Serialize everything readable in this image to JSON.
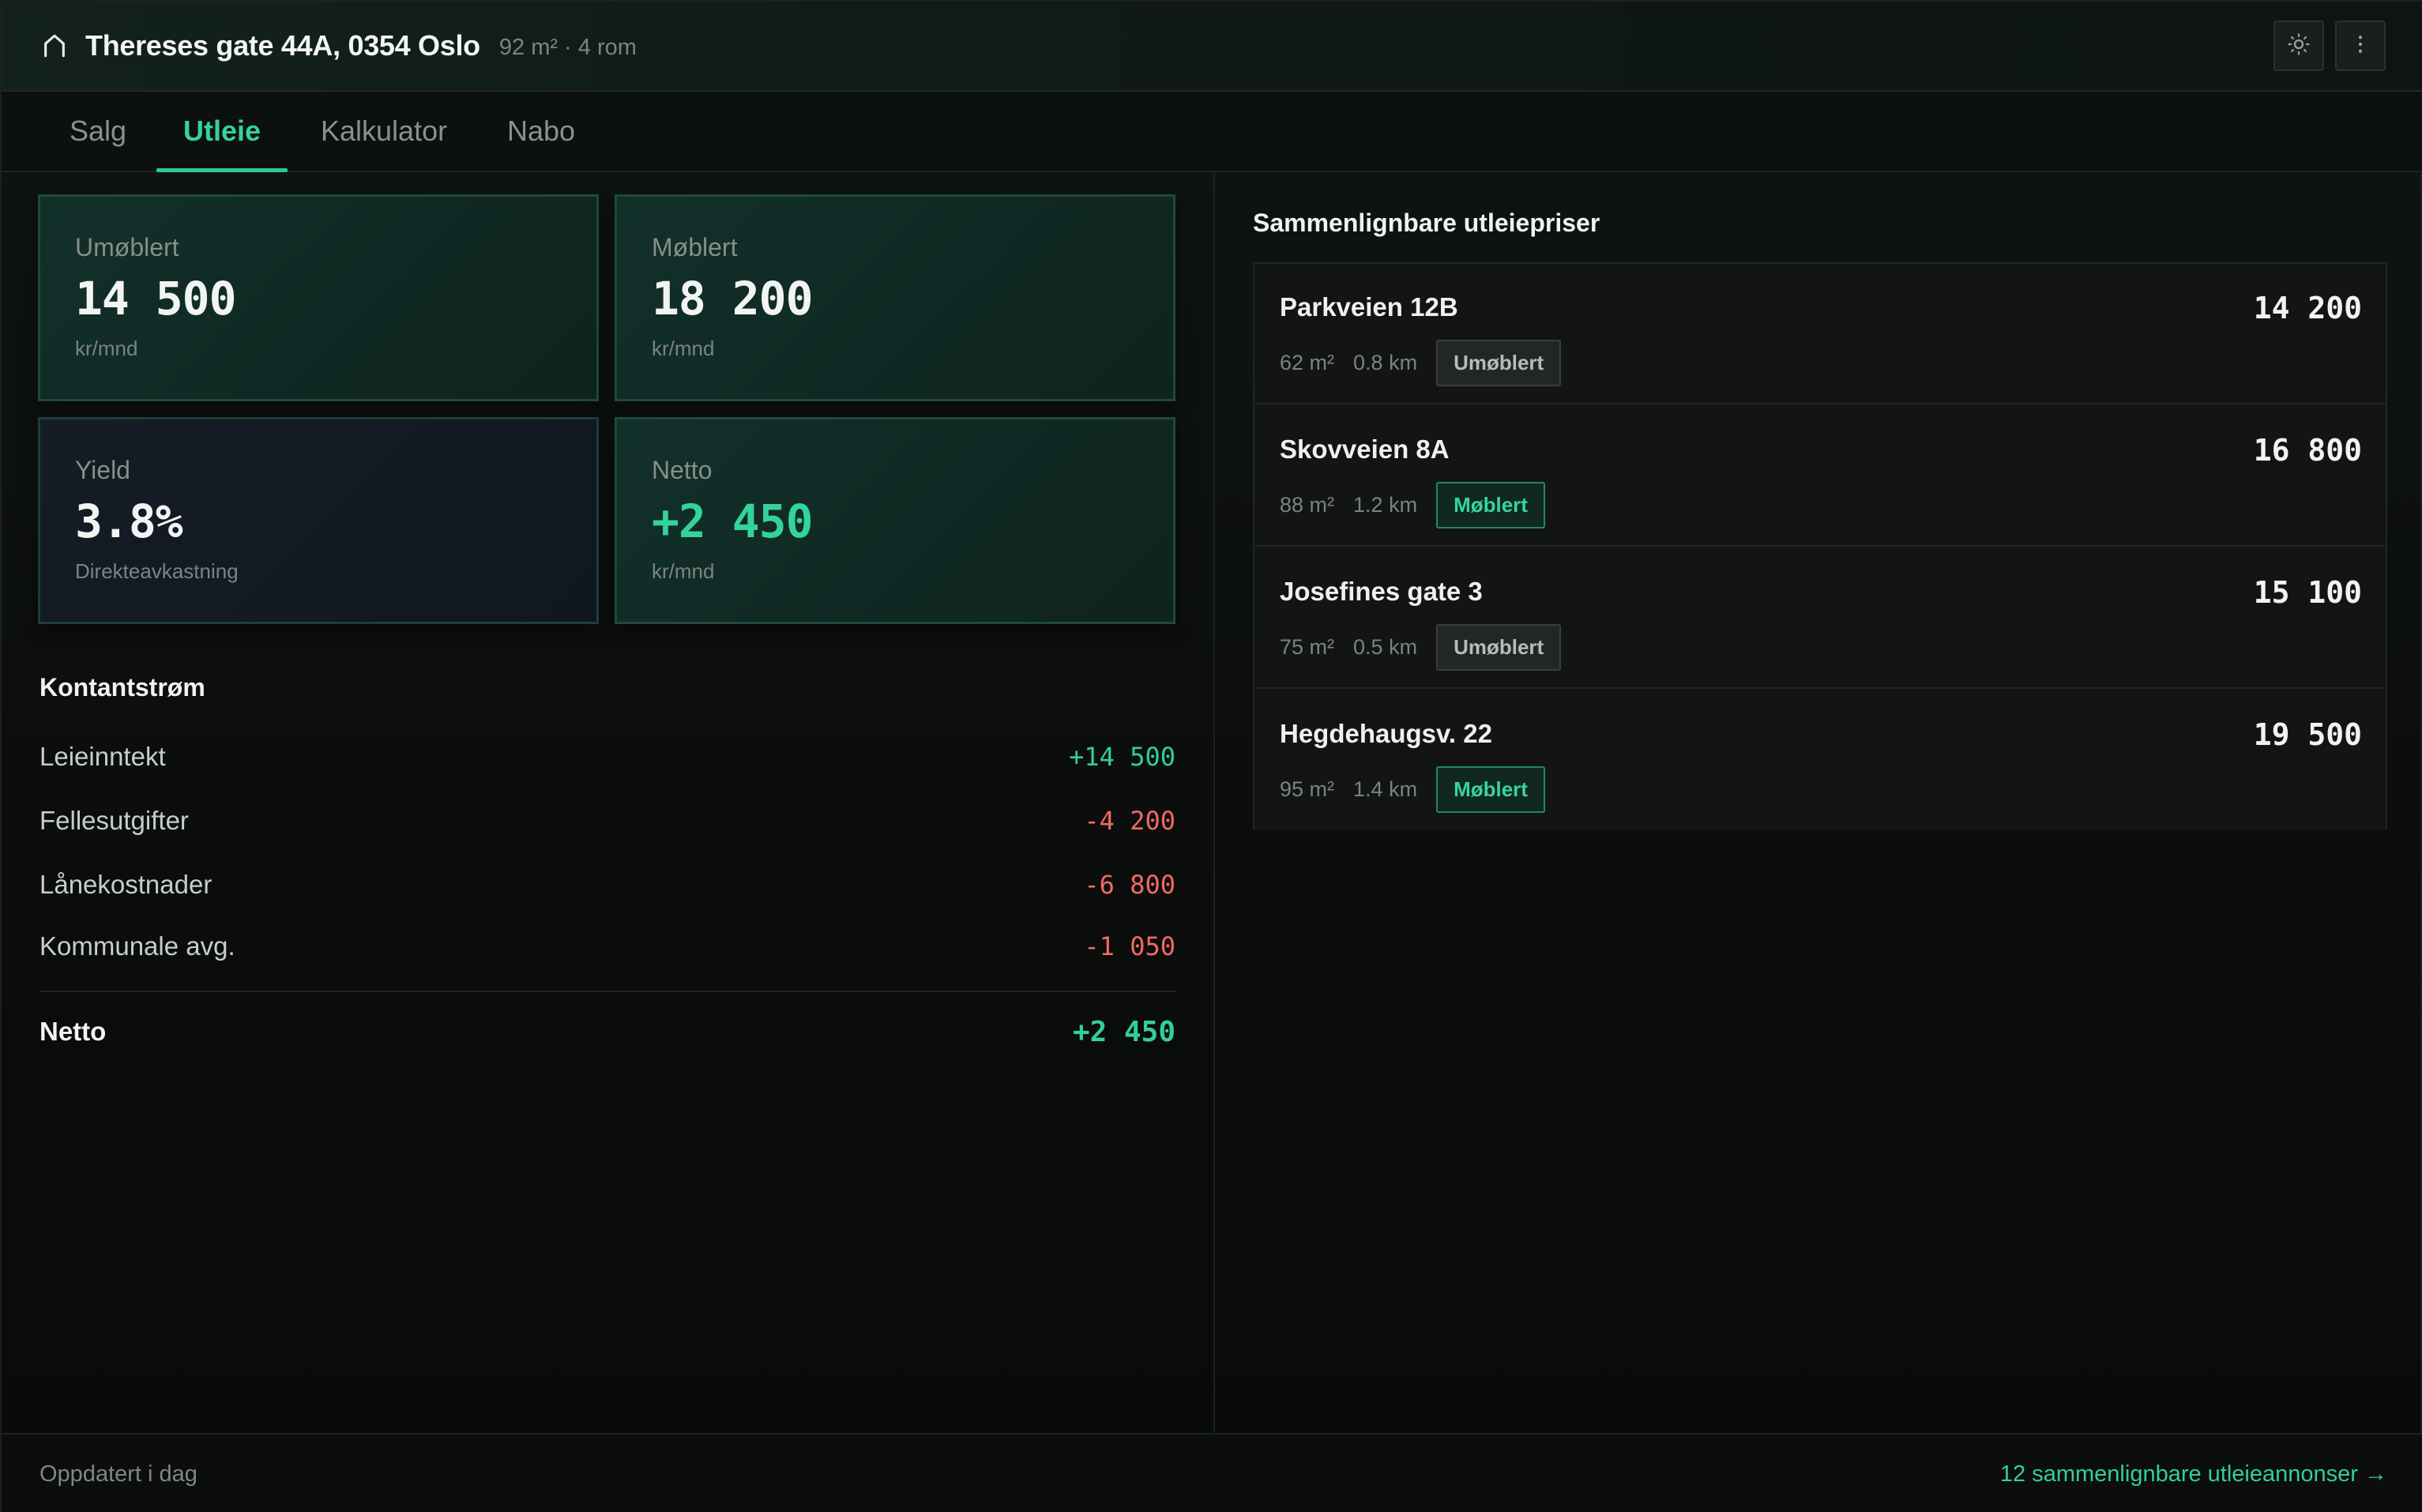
{
  "header": {
    "title": "Thereses gate 44A, 0354 Oslo",
    "subtitle": "92 m² · 4 rom",
    "icons": {
      "home": "home-icon",
      "theme": "sun-icon",
      "more": "more-vertical-icon"
    }
  },
  "tabs": [
    {
      "label": "Salg",
      "active": false
    },
    {
      "label": "Utleie",
      "active": true
    },
    {
      "label": "Kalkulator",
      "active": false
    },
    {
      "label": "Nabo",
      "active": false
    }
  ],
  "cards": [
    {
      "label": "Umøblert",
      "value": "14 500",
      "unit": "kr/mnd"
    },
    {
      "label": "Møblert",
      "value": "18 200",
      "unit": "kr/mnd"
    },
    {
      "label": "Yield",
      "value": "3.8%",
      "unit": "Direkteavkastning"
    },
    {
      "label": "Netto",
      "value": "+2 450",
      "unit": "kr/mnd"
    }
  ],
  "cashflow": {
    "title": "Kontantstrøm",
    "rows": [
      {
        "label": "Leieinntekt",
        "value": "+14 500"
      },
      {
        "label": "Fellesutgifter",
        "value": "-4 200"
      },
      {
        "label": "Lånekostnader",
        "value": "-6 800"
      },
      {
        "label": "Kommunale avg.",
        "value": "-1 050"
      }
    ],
    "total": {
      "label": "Netto",
      "value": "+2 450"
    }
  },
  "comparables": {
    "title": "Sammenlignbare utleiepriser",
    "items": [
      {
        "name": "Parkveien 12B",
        "size": "62 m²",
        "distance": "0.8 km",
        "badge": "Umøblert",
        "price": "14 200"
      },
      {
        "name": "Skovveien 8A",
        "size": "88 m²",
        "distance": "1.2 km",
        "badge": "Møblert",
        "price": "16 800"
      },
      {
        "name": "Josefines gate 3",
        "size": "75 m²",
        "distance": "0.5 km",
        "badge": "Umøblert",
        "price": "15 100"
      },
      {
        "name": "Hegdehaugsv. 22",
        "size": "95 m²",
        "distance": "1.4 km",
        "badge": "Møblert",
        "price": "19 500"
      }
    ]
  },
  "footer": {
    "updated": "Oppdatert i dag",
    "link": "12 sammenlignbare utleieannonser →"
  },
  "colors": {
    "accent": "#33d39a",
    "negative": "#f06a62",
    "background": "#0b0c0c"
  }
}
